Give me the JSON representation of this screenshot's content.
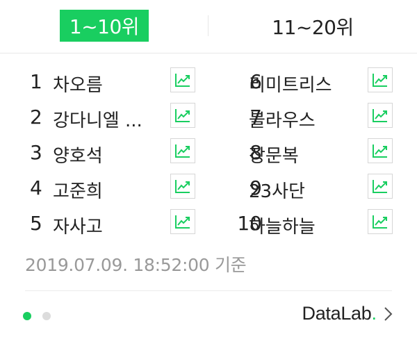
{
  "tabs": [
    {
      "label": "1~10위",
      "active": true
    },
    {
      "label": "11~20위",
      "active": false
    }
  ],
  "rankings_left": [
    {
      "rank": "1",
      "keyword": "차오름"
    },
    {
      "rank": "2",
      "keyword": "강다니엘 ..."
    },
    {
      "rank": "3",
      "keyword": "양호석"
    },
    {
      "rank": "4",
      "keyword": "고준희"
    },
    {
      "rank": "5",
      "keyword": "자사고"
    }
  ],
  "rankings_right": [
    {
      "rank": "6",
      "keyword": "리미트리스"
    },
    {
      "rank": "7",
      "keyword": "블라우스"
    },
    {
      "rank": "8",
      "keyword": "장문복"
    },
    {
      "rank": "9",
      "keyword": "23사단"
    },
    {
      "rank": "10",
      "keyword": "하늘하늘"
    }
  ],
  "timestamp": "2019.07.09. 18:52:00 기준",
  "footer": {
    "brand": "DataLab",
    "brand_dot": ".",
    "page_indicator": {
      "current": 1,
      "total": 2
    }
  },
  "icons": {
    "trend": "trend-chart-icon",
    "next": "chevron-right-icon"
  },
  "colors": {
    "accent": "#19ce60",
    "muted_text": "#999999",
    "border": "#d6d6d6"
  }
}
